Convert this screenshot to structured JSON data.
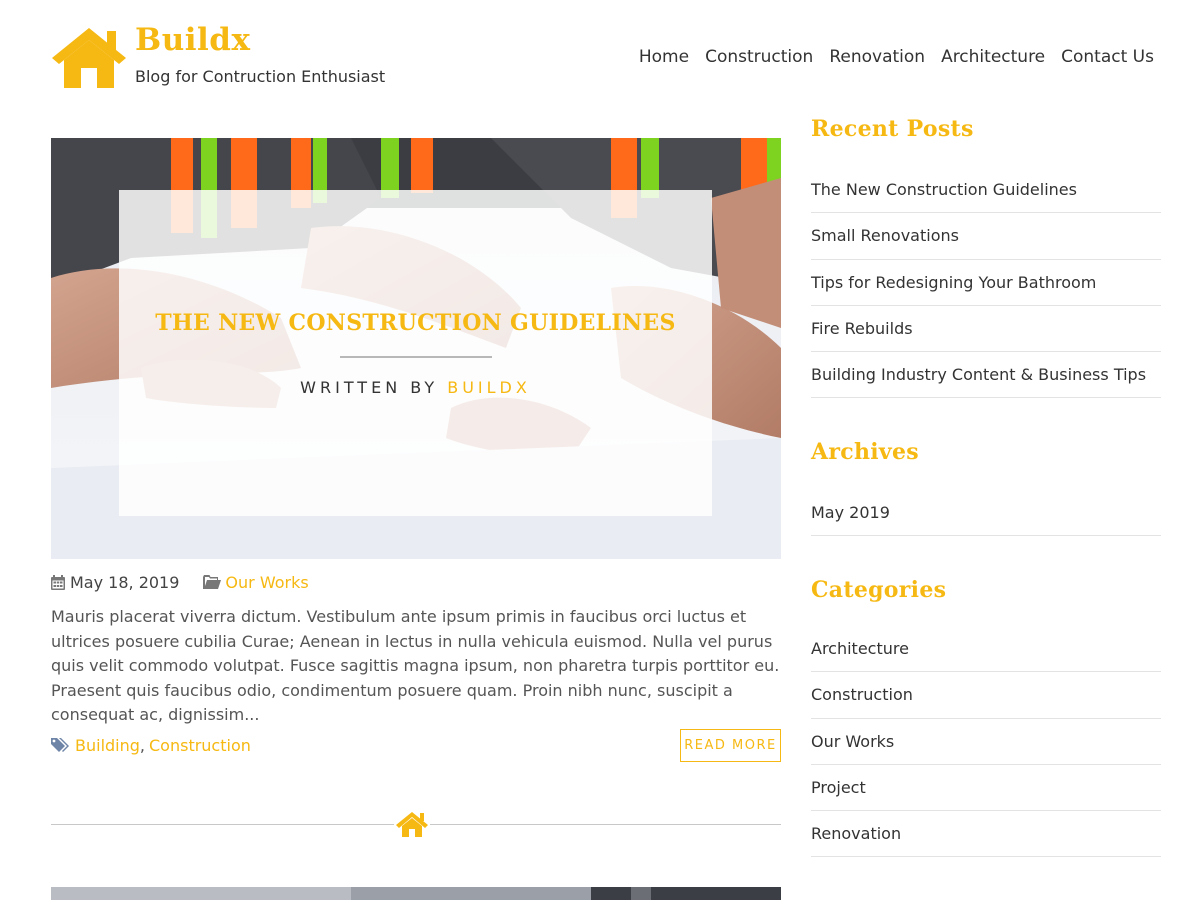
{
  "header": {
    "site_title": "Buildx",
    "tagline": "Blog for Contruction Enthusiast",
    "brand_color": "#f6b812",
    "logo_icon": "house-icon",
    "nav": [
      {
        "label": "Home"
      },
      {
        "label": "Construction"
      },
      {
        "label": "Renovation"
      },
      {
        "label": "Architecture"
      },
      {
        "label": "Contact Us"
      }
    ]
  },
  "post": {
    "title": "THE NEW CONSTRUCTION GUIDELINES",
    "written_by": "WRITTEN BY",
    "author": "BUILDX",
    "date": "May 18, 2019",
    "date_icon": "calendar-icon",
    "category": "Our Works",
    "category_icon": "folder-icon",
    "excerpt": "Mauris placerat viverra dictum. Vestibulum ante ipsum primis in faucibus orci luctus et ultrices posuere cubilia Curae; Aenean in lectus in nulla vehicula euismod. Nulla vel purus quis velit commodo volutpat. Fusce sagittis magna ipsum, non pharetra turpis porttitor eu. Praesent quis faucibus odio, condimentum posuere quam. Proin nibh nunc, suscipit a consequat ac, dignissim...",
    "tags_icon": "tags-icon",
    "tags": [
      "Building",
      "Construction"
    ],
    "tag_separator": ",",
    "read_more": "READ MORE",
    "divider_icon": "house-icon"
  },
  "sidebar": {
    "recent_posts": {
      "title": "Recent Posts",
      "items": [
        "The New Construction Guidelines",
        "Small Renovations",
        "Tips for Redesigning Your Bathroom",
        "Fire Rebuilds",
        "Building Industry Content & Business Tips"
      ]
    },
    "archives": {
      "title": "Archives",
      "items": [
        "May 2019"
      ]
    },
    "categories": {
      "title": "Categories",
      "items": [
        "Architecture",
        "Construction",
        "Our Works",
        "Project",
        "Renovation"
      ]
    }
  }
}
